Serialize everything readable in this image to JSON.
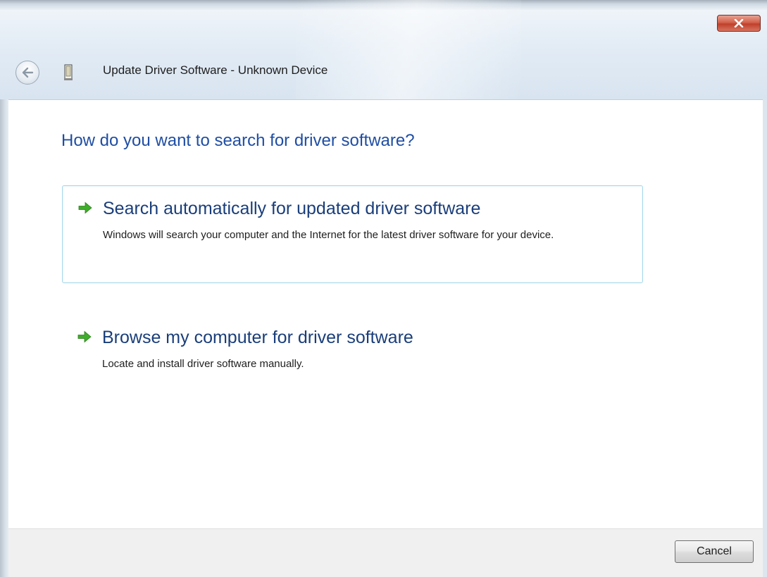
{
  "window": {
    "title": "Update Driver Software - Unknown Device"
  },
  "heading": "How do you want to search for driver software?",
  "options": [
    {
      "title": "Search automatically for updated driver software",
      "description": "Windows will search your computer and the Internet for the latest driver software for your device.",
      "icon": "green-arrow-icon",
      "selected": true
    },
    {
      "title": "Browse my computer for driver software",
      "description": "Locate and install driver software manually.",
      "icon": "green-arrow-icon",
      "selected": false
    }
  ],
  "footer": {
    "cancel_label": "Cancel"
  },
  "colors": {
    "heading": "#1f4ea3",
    "option_title": "#1a3e7a",
    "arrow": "#3fae2a",
    "selected_border": "#a7d8ea",
    "close_button": "#c0402a"
  }
}
